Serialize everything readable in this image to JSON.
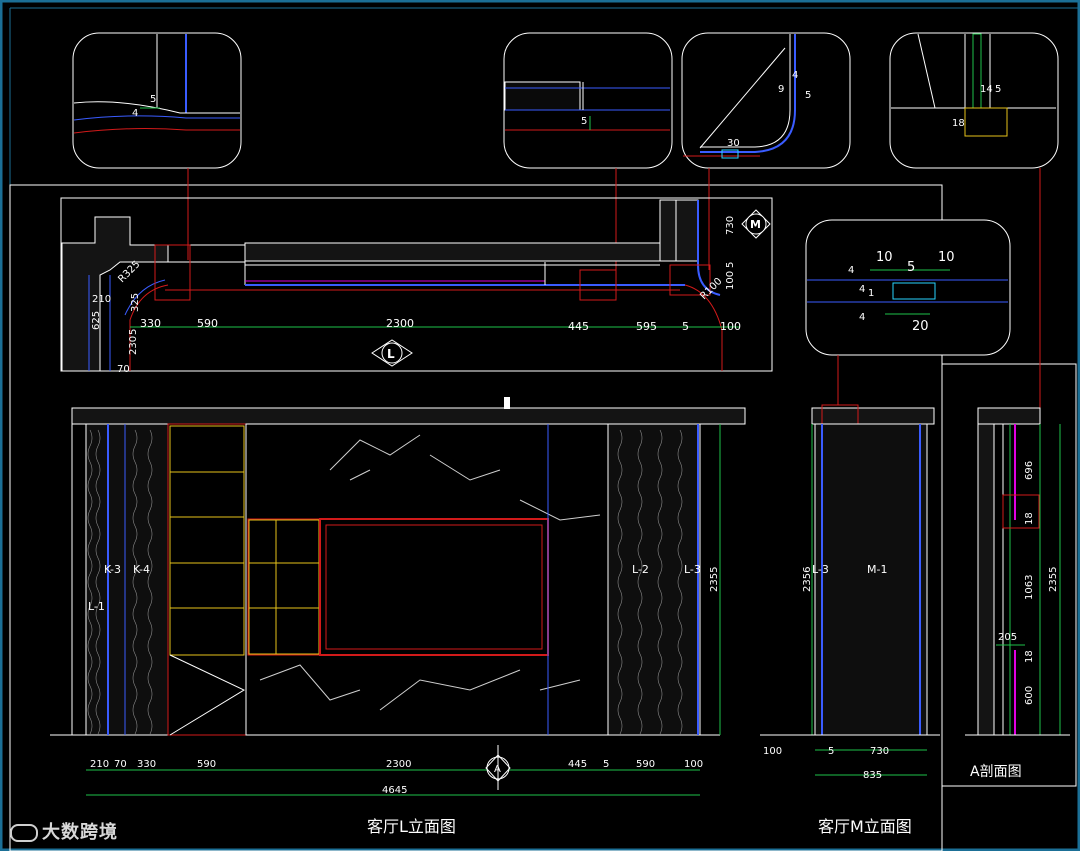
{
  "colors": {
    "background": "#000000",
    "frame": "#1b6f96",
    "outline": "#ffffff",
    "blue": "#3a5cff",
    "red": "#d21a1a",
    "yellow": "#e6c21a",
    "green": "#1ec24a",
    "magenta": "#e000e0",
    "cyan": "#29d3ff"
  },
  "plan": {
    "marker_L": "L",
    "marker_M": "M",
    "dims_bottom": [
      "330",
      "590",
      "2300",
      "445",
      "595",
      "5",
      "100"
    ],
    "dims_left": [
      "210",
      "625",
      "230",
      "5",
      "70",
      "325"
    ],
    "dims_right": [
      "730",
      "100",
      "5",
      "R100"
    ],
    "radius_left": "R325"
  },
  "detail_1": {
    "dims": [
      "5",
      "4"
    ]
  },
  "detail_2": {
    "dims": [
      "5"
    ]
  },
  "detail_3": {
    "dims": [
      "4",
      "9",
      "5",
      "30"
    ]
  },
  "detail_4": {
    "dims": [
      "14",
      "5",
      "18"
    ]
  },
  "detail_5": {
    "dims": [
      "10",
      "5",
      "10",
      "4",
      "4",
      "1",
      "4",
      "20"
    ]
  },
  "elevation_L": {
    "marker": "A",
    "tags": [
      "K-3",
      "K-4",
      "L-1",
      "L-2",
      "L-3"
    ],
    "height": "2355",
    "dims_bottom": [
      "210",
      "70",
      "330",
      "590",
      "2300",
      "445",
      "5",
      "590",
      "100"
    ],
    "total": "4645",
    "title": "客厅L立面图"
  },
  "elevation_M": {
    "tags": [
      "L-3",
      "M-1"
    ],
    "height": "2356",
    "dims_bottom": [
      "100",
      "5",
      "730"
    ],
    "total": "835",
    "title": "客厅M立面图"
  },
  "section_A": {
    "dims_right": [
      "696",
      "18",
      "1063",
      "18",
      "600"
    ],
    "dim_inner": "205",
    "height": "2355",
    "title": "A剖面图"
  },
  "watermark": "大数跨境"
}
